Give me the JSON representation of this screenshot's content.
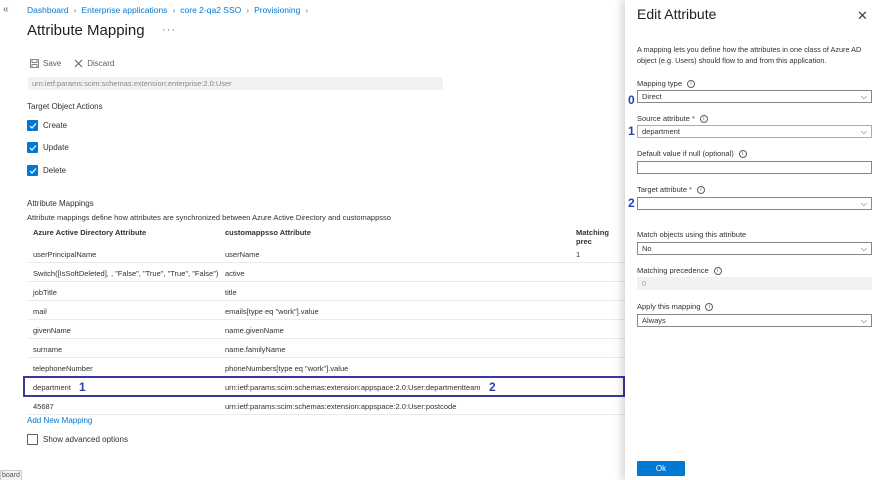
{
  "breadcrumb": [
    "Dashboard",
    "Enterprise applications",
    "core 2-qa2 SSO",
    "Provisioning"
  ],
  "page_title": "Attribute Mapping",
  "title_more": "···",
  "toolbar": {
    "save_label": "Save",
    "discard_label": "Discard"
  },
  "schema_urn": "urn:ietf:params:scim:schemas:extension:enterprise:2.0:User",
  "target_object_actions": {
    "heading": "Target Object Actions",
    "items": [
      {
        "label": "Create",
        "checked": true
      },
      {
        "label": "Update",
        "checked": true
      },
      {
        "label": "Delete",
        "checked": true
      }
    ]
  },
  "attribute_mappings": {
    "heading": "Attribute Mappings",
    "description": "Attribute mappings define how attributes are synchronized between Azure Active Directory and customappsso",
    "columns": [
      "Azure Active Directory Attribute",
      "customappsso Attribute",
      "Matching prec"
    ],
    "rows": [
      {
        "source": "userPrincipalName",
        "target": "userName",
        "precedence": "1"
      },
      {
        "source": "Switch([IsSoftDeleted], , \"False\", \"True\", \"True\", \"False\")",
        "target": "active",
        "precedence": ""
      },
      {
        "source": "jobTitle",
        "target": "title",
        "precedence": ""
      },
      {
        "source": "mail",
        "target": "emails[type eq \"work\"].value",
        "precedence": ""
      },
      {
        "source": "givenName",
        "target": "name.givenName",
        "precedence": ""
      },
      {
        "source": "surname",
        "target": "name.familyName",
        "precedence": ""
      },
      {
        "source": "telephoneNumber",
        "target": "phoneNumbers[type eq \"work\"].value",
        "precedence": ""
      },
      {
        "source": "department",
        "target": "urn:ietf:params:scim:schemas:extension:appspace:2.0:User:departmentteam",
        "precedence": ""
      },
      {
        "source": "45687",
        "target": "urn:ietf:params:scim:schemas:extension:appspace:2.0:User:postcode",
        "precedence": ""
      }
    ],
    "add_link": "Add New Mapping",
    "show_advanced": "Show advanced options"
  },
  "annotations": {
    "row_source_marker": "1",
    "row_target_marker": "2",
    "mapping_type_marker": "0",
    "source_marker": "1",
    "target_marker": "2"
  },
  "bottom_tab": "board",
  "edit_panel": {
    "title": "Edit Attribute",
    "close": "✕",
    "description": "A mapping lets you define how the attributes in one class of Azure AD object (e.g. Users) should flow to and from this application.",
    "mapping_type_label": "Mapping type",
    "mapping_type_value": "Direct",
    "source_attribute_label": "Source attribute",
    "source_attribute_value": "department",
    "default_value_label": "Default value if null (optional)",
    "default_value": "",
    "target_attribute_label": "Target attribute",
    "target_attribute_value": "",
    "match_objects_label": "Match objects using this attribute",
    "match_objects_value": "No",
    "matching_precedence_label": "Matching precedence",
    "matching_precedence_value": "0",
    "apply_mapping_label": "Apply this mapping",
    "apply_mapping_value": "Always",
    "ok_label": "Ok",
    "required_mark": "*"
  },
  "colors": {
    "accent": "#0078d4",
    "annotation": "#2b3fb3",
    "required": "#a4262c"
  }
}
